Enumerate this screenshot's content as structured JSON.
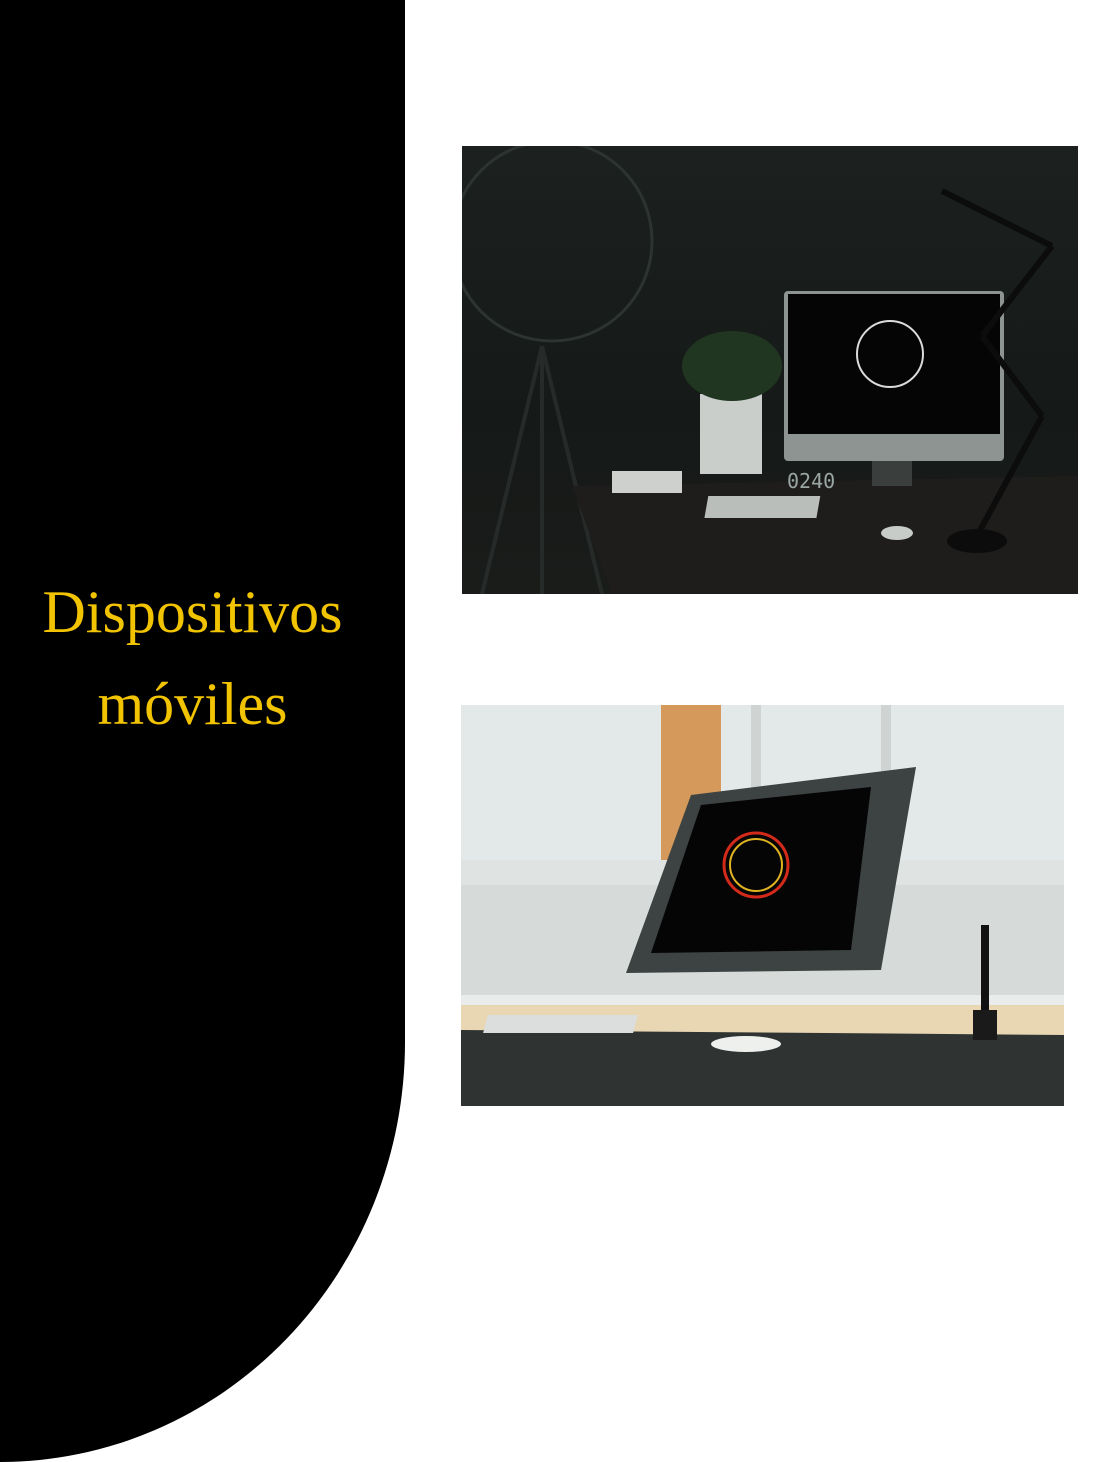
{
  "slide": {
    "title_line1": "Dispositivos",
    "title_line2": "móviles"
  },
  "photos": [
    {
      "name": "dark-desk-imac",
      "clock": "0240"
    },
    {
      "name": "bright-desk-drawing-tablet"
    }
  ],
  "colors": {
    "panel": "#000000",
    "title": "#f2c300",
    "background": "#ffffff"
  }
}
